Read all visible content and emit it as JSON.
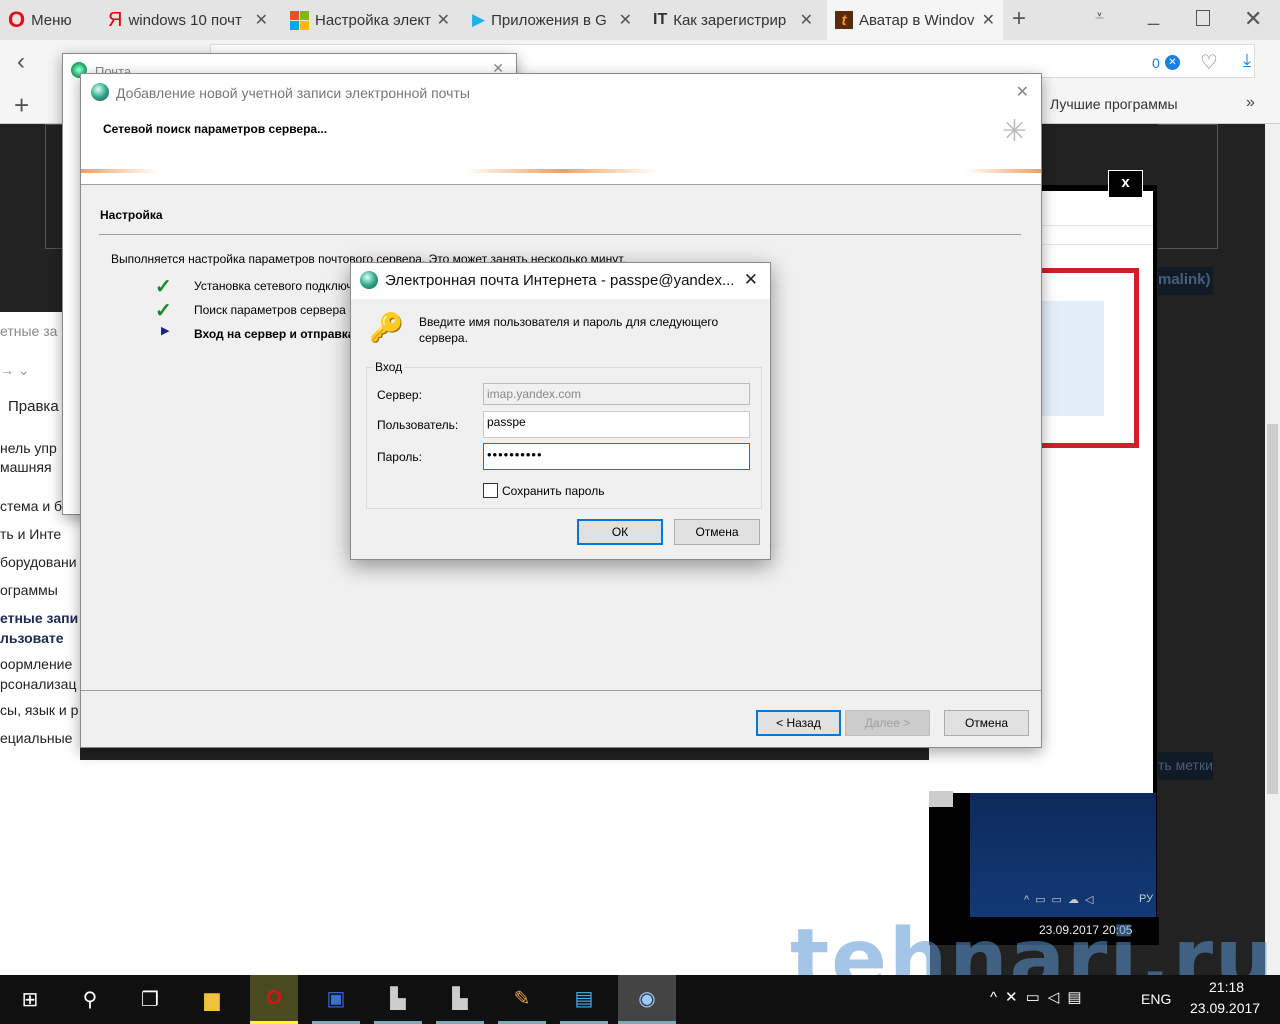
{
  "browser": {
    "menu_label": "Меню",
    "tabs": [
      {
        "title": "windows 10 почт",
        "icon": "yandex-icon"
      },
      {
        "title": "Настройка элект",
        "icon": "microsoft-icon"
      },
      {
        "title": "Приложения в G",
        "icon": "google-play-icon"
      },
      {
        "title": "Как зарегистрир",
        "icon": "it-icon"
      },
      {
        "title": "Аватар в Windov",
        "icon": "tehnari-icon",
        "active": true
      }
    ],
    "adblock_count": "0",
    "bookmark": "Лучшие программы",
    "more": "»"
  },
  "control_panel": {
    "title": "етные за",
    "menu_edit": "Правка",
    "items": [
      "нель упр",
      "машняя",
      "стема и б",
      "ть и Инте",
      "борудовани",
      "ограммы",
      "етные запи",
      "льзовате",
      "оормление",
      "рсонализац",
      "сы, язык и р",
      "ециальные"
    ]
  },
  "mail_window": {
    "title": "Почта"
  },
  "wizard": {
    "title": "Добавление новой учетной записи электронной почты",
    "header": "Сетевой поиск параметров сервера...",
    "section": "Настройка",
    "intro": "Выполняется настройка параметров почтового сервера. Это может занять несколько минут.",
    "steps": [
      {
        "label": "Установка сетевого подключения",
        "state": "done"
      },
      {
        "label": "Поиск параметров сервера",
        "state": "done"
      },
      {
        "label": "Вход на сервер и отправка",
        "state": "current"
      }
    ],
    "back": "< Назад",
    "next": "Далее >",
    "cancel": "Отмена"
  },
  "login_dialog": {
    "title": "Электронная почта Интернета - passpe@yandex...",
    "message": "Введите имя пользователя и пароль для следующего сервера.",
    "group": "Вход",
    "server_label": "Сервер:",
    "server_value": "imap.yandex.com",
    "user_label": "Пользователь:",
    "user_value": "passpe",
    "password_label": "Пароль:",
    "password_value": "••••••••••",
    "save_password": "Сохранить пароль",
    "save_password_checked": false,
    "ok": "ОК",
    "cancel": "Отмена"
  },
  "lightbox": {
    "close": "x",
    "tray_lang": "РУ",
    "tray_datetime": "23.09.2017 20:05",
    "page_tags": "ть метки",
    "permalink": "malink)"
  },
  "watermark": "tehnari.ru",
  "taskbar": {
    "lang": "ENG",
    "time": "21:18",
    "date": "23.09.2017"
  }
}
